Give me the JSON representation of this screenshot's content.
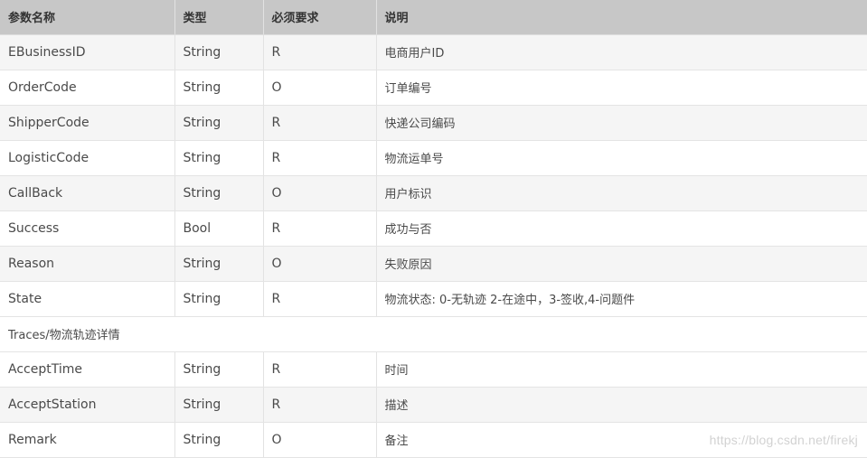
{
  "table": {
    "headers": [
      "参数名称",
      "类型",
      "必须要求",
      "说明"
    ],
    "rows": [
      [
        "EBusinessID",
        "String",
        "R",
        "电商用户ID"
      ],
      [
        "OrderCode",
        "String",
        "O",
        "订单编号"
      ],
      [
        "ShipperCode",
        "String",
        "R",
        "快递公司编码"
      ],
      [
        "LogisticCode",
        "String",
        "R",
        "物流运单号"
      ],
      [
        "CallBack",
        "String",
        "O",
        "用户标识"
      ],
      [
        "Success",
        "Bool",
        "R",
        "成功与否"
      ],
      [
        "Reason",
        "String",
        "O",
        "失败原因"
      ],
      [
        "State",
        "String",
        "R",
        "物流状态: 0-无轨迹 2-在途中，3-签收,4-问题件"
      ]
    ],
    "group_label": "Traces/物流轨迹详情",
    "group_rows": [
      [
        "AcceptTime",
        "String",
        "R",
        "时间"
      ],
      [
        "AcceptStation",
        "String",
        "R",
        "描述"
      ],
      [
        "Remark",
        "String",
        "O",
        "备注"
      ]
    ]
  },
  "watermark": "https://blog.csdn.net/firekj"
}
